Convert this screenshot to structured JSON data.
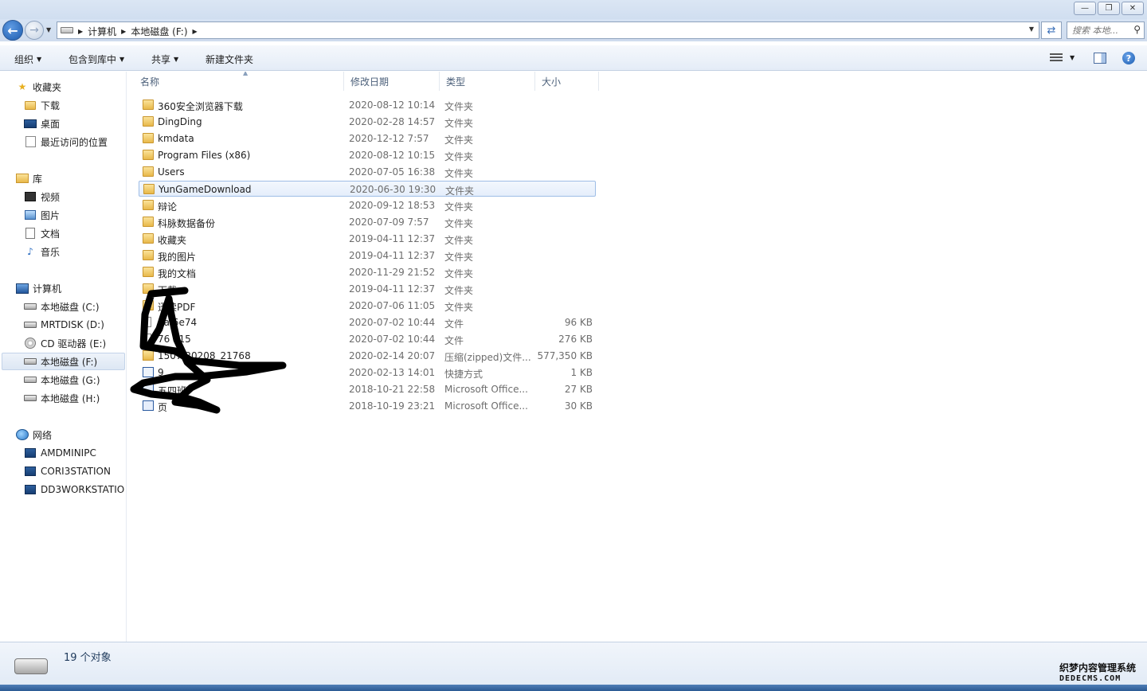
{
  "window": {
    "minimize_glyph": "—",
    "restore_glyph": "❐",
    "close_glyph": "✕"
  },
  "address": {
    "crumbs": [
      "计算机",
      "本地磁盘 (F:)"
    ],
    "search_placeholder": "搜索 本地..."
  },
  "toolbar": {
    "organize": "组织",
    "include_library": "包含到库中",
    "share": "共享",
    "new_folder": "新建文件夹",
    "help": "?"
  },
  "nav": {
    "favorites": "收藏夹",
    "downloads": "下载",
    "desktop": "桌面",
    "recent": "最近访问的位置",
    "libraries": "库",
    "videos": "视频",
    "pictures": "图片",
    "documents": "文档",
    "music": "音乐",
    "computer": "计算机",
    "drive_c": "本地磁盘 (C:)",
    "drive_d": "MRTDISK (D:)",
    "drive_e": "CD 驱动器 (E:)",
    "drive_f": "本地磁盘 (F:)",
    "drive_g": "本地磁盘 (G:)",
    "drive_h": "本地磁盘 (H:)",
    "network": "网络",
    "pc1": "AMDMINIPC",
    "pc2": "CORI3STATION",
    "pc3": "DD3WORKSTATIO"
  },
  "columns": {
    "name": "名称",
    "modified": "修改日期",
    "type": "类型",
    "size": "大小"
  },
  "files": [
    {
      "name": "360安全浏览器下载",
      "date": "2020-08-12 10:14",
      "type": "文件夹",
      "size": "",
      "icon": "folder"
    },
    {
      "name": "DingDing",
      "date": "2020-02-28 14:57",
      "type": "文件夹",
      "size": "",
      "icon": "folder"
    },
    {
      "name": "kmdata",
      "date": "2020-12-12 7:57",
      "type": "文件夹",
      "size": "",
      "icon": "folder"
    },
    {
      "name": "Program Files (x86)",
      "date": "2020-08-12 10:15",
      "type": "文件夹",
      "size": "",
      "icon": "folder"
    },
    {
      "name": "Users",
      "date": "2020-07-05 16:38",
      "type": "文件夹",
      "size": "",
      "icon": "folder"
    },
    {
      "name": "YunGameDownload",
      "date": "2020-06-30 19:30",
      "type": "文件夹",
      "size": "",
      "icon": "folder"
    },
    {
      "name": "辩论",
      "date": "2020-09-12 18:53",
      "type": "文件夹",
      "size": "",
      "icon": "folder"
    },
    {
      "name": "科脉数据备份",
      "date": "2020-07-09 7:57",
      "type": "文件夹",
      "size": "",
      "icon": "folder"
    },
    {
      "name": "收藏夹",
      "date": "2019-04-11 12:37",
      "type": "文件夹",
      "size": "",
      "icon": "folder"
    },
    {
      "name": "我的图片",
      "date": "2019-04-11 12:37",
      "type": "文件夹",
      "size": "",
      "icon": "folder"
    },
    {
      "name": "我的文档",
      "date": "2020-11-29 21:52",
      "type": "文件夹",
      "size": "",
      "icon": "folder"
    },
    {
      "name": "下载",
      "date": "2019-04-11 12:37",
      "type": "文件夹",
      "size": "",
      "icon": "folder"
    },
    {
      "name": "迅读PDF",
      "date": "2020-07-06 11:05",
      "type": "文件夹",
      "size": "",
      "icon": "folder"
    },
    {
      "name": "4a  6e74",
      "date": "2020-07-02 10:44",
      "type": "文件",
      "size": "96 KB",
      "icon": "file"
    },
    {
      "name": "76   e15",
      "date": "2020-07-02 10:44",
      "type": "文件",
      "size": "276 KB",
      "icon": "file"
    },
    {
      "name": "1507     20208_21768",
      "date": "2020-02-14 20:07",
      "type": "压缩(zipped)文件...",
      "size": "577,350 KB",
      "icon": "zip"
    },
    {
      "name": "         9",
      "date": "2020-02-13 14:01",
      "type": "快捷方式",
      "size": "1 KB",
      "icon": "link"
    },
    {
      "name": "五四班",
      "date": "2018-10-21 22:58",
      "type": "Microsoft Office...",
      "size": "27 KB",
      "icon": "word"
    },
    {
      "name": "              页",
      "date": "2018-10-19 23:21",
      "type": "Microsoft Office...",
      "size": "30 KB",
      "icon": "word"
    }
  ],
  "status": {
    "count": "19 个对象"
  },
  "watermark": {
    "line1": "织梦内容管理系统",
    "line2": "DEDECMS.COM"
  },
  "colors": {
    "selection_border": "#9ebde6",
    "link_text": "#1e395b"
  }
}
